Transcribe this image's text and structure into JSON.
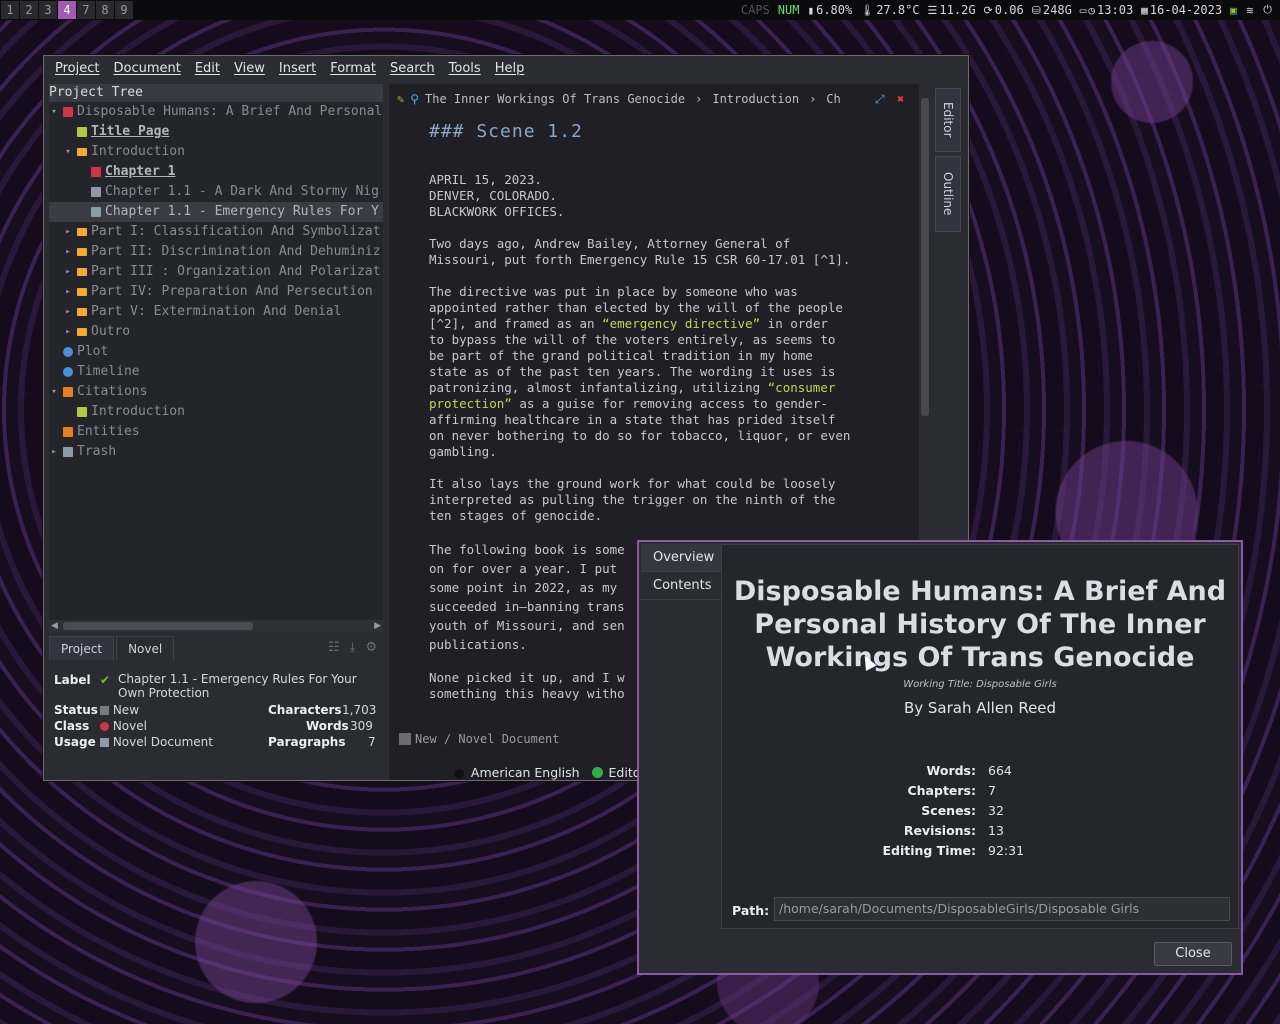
{
  "topbar": {
    "workspaces": [
      "1",
      "2",
      "3",
      "4",
      "7",
      "8",
      "9"
    ],
    "active_workspace": "4",
    "caps": "CAPS",
    "num": "NUM",
    "cpu": "6.80%",
    "temp": "27.8°C",
    "mem": "11.2G",
    "load": "0.06",
    "disk": "248G",
    "time": "13:03",
    "date": "16-04-2023"
  },
  "menu": [
    "Project",
    "Document",
    "Edit",
    "View",
    "Insert",
    "Format",
    "Search",
    "Tools",
    "Help"
  ],
  "tree": {
    "header": "Project Tree",
    "items": [
      {
        "label": "Disposable Humans: A Brief And Personal",
        "depth": 0,
        "arrow": "▾",
        "icon": "ti-red"
      },
      {
        "label": "Title Page",
        "depth": 1,
        "arrow": "",
        "icon": "ti-green",
        "style": "bold"
      },
      {
        "label": "Introduction",
        "depth": 1,
        "arrow": "▾",
        "icon": "ti-folder"
      },
      {
        "label": "Chapter 1",
        "depth": 2,
        "arrow": "",
        "icon": "ti-red",
        "style": "bold"
      },
      {
        "label": "Chapter 1.1 - A Dark And Stormy Nig",
        "depth": 2,
        "arrow": "",
        "icon": "ti-gray"
      },
      {
        "label": "Chapter 1.1 - Emergency Rules For Y",
        "depth": 2,
        "arrow": "",
        "icon": "ti-gray",
        "selected": true,
        "style": "light"
      },
      {
        "label": "Part I: Classification And Symbolizat",
        "depth": 1,
        "arrow": "▸",
        "icon": "ti-folder"
      },
      {
        "label": "Part II: Discrimination And Dehuminiz",
        "depth": 1,
        "arrow": "▸",
        "icon": "ti-folder"
      },
      {
        "label": "Part III : Organization And Polarizat",
        "depth": 1,
        "arrow": "▸",
        "icon": "ti-folder"
      },
      {
        "label": "Part IV: Preparation And Persecution",
        "depth": 1,
        "arrow": "▸",
        "icon": "ti-folder"
      },
      {
        "label": "Part V: Extermination And Denial",
        "depth": 1,
        "arrow": "▸",
        "icon": "ti-folder"
      },
      {
        "label": "Outro",
        "depth": 1,
        "arrow": "▸",
        "icon": "ti-folder"
      },
      {
        "label": "Plot",
        "depth": 0,
        "arrow": "",
        "icon": "ti-blue"
      },
      {
        "label": "Timeline",
        "depth": 0,
        "arrow": "",
        "icon": "ti-blue"
      },
      {
        "label": "Citations",
        "depth": 0,
        "arrow": "▾",
        "icon": "ti-orange"
      },
      {
        "label": "Introduction",
        "depth": 1,
        "arrow": "",
        "icon": "ti-green"
      },
      {
        "label": "Entities",
        "depth": 0,
        "arrow": "",
        "icon": "ti-orange"
      },
      {
        "label": "Trash",
        "depth": 0,
        "arrow": "▸",
        "icon": "ti-gray"
      }
    ]
  },
  "bottom_tabs": [
    "Project",
    "Novel"
  ],
  "details": {
    "label_key": "Label",
    "label_value": "Chapter 1.1 - Emergency Rules For Your Own Protection",
    "status_key": "Status",
    "status_value": "New",
    "class_key": "Class",
    "class_value": "Novel",
    "usage_key": "Usage",
    "usage_value": "Novel Document",
    "characters_key": "Characters",
    "characters_value": "1,703",
    "words_key": "Words",
    "words_value": "309",
    "paragraphs_key": "Paragraphs",
    "paragraphs_value": "7"
  },
  "editor": {
    "breadcrumb": [
      "The Inner Workings Of Trans Genocide",
      "Introduction",
      "Ch"
    ],
    "heading": "### Scene 1.2",
    "p1": "APRIL 15, 2023.\nDENVER, COLORADO.\nBLACKWORK OFFICES.",
    "p2": "Two days ago, Andrew Bailey, Attorney General of\nMissouri, put forth Emergency Rule 15 CSR 60-17.01 [^1].",
    "p3a": "The directive was put in place by someone who was\nappointed rather than elected by the will of the people\n[^2], and framed as an ",
    "p3q1": "“emergency directive”",
    "p3b": " in order\nto bypass the will of the voters entirely, as seems to\nbe part of the grand political tradition in my home\nstate as of the past ten years. The wording it uses is\npatronizing, almost infantalizing, utilizing ",
    "p3q2": "“consumer\nprotection”",
    "p3c": " as a guise for removing access to gender-\naffirming healthcare in a state that has prided itself\non never bothering to do so for tobacco, liquor, or even\ngambling.",
    "p4": "It also lays the ground work for what could be loosely\ninterpreted as pulling the trigger on the ninth of the\nten stages of genocide.",
    "p5": "The following book is some\non for over a year. I put\nsome point in 2022, as my\nsucceeded in—banning trans\nyouth of Missouri, and sen\npublications.",
    "p6": "None picked it up, and I w\nsomething this heavy witho",
    "footer": "New / Novel Document"
  },
  "side_tabs": [
    "Editor",
    "Outline"
  ],
  "statusbar": {
    "language": "American English",
    "mode": "Editor"
  },
  "dialog": {
    "tabs": [
      "Overview",
      "Contents"
    ],
    "title": "Disposable Humans: A Brief And Personal History Of The Inner Workings Of Trans Genocide",
    "working_title": "Working Title: Disposable Girls",
    "author": "By Sarah Allen Reed",
    "stats": [
      {
        "key": "Words:",
        "value": "664"
      },
      {
        "key": "Chapters:",
        "value": "7"
      },
      {
        "key": "Scenes:",
        "value": "32"
      },
      {
        "key": "Revisions:",
        "value": "13"
      },
      {
        "key": "Editing Time:",
        "value": "92:31"
      }
    ],
    "path_label": "Path:",
    "path_value": "/home/sarah/Documents/DisposableGirls/Disposable Girls",
    "close_label": "Close"
  }
}
